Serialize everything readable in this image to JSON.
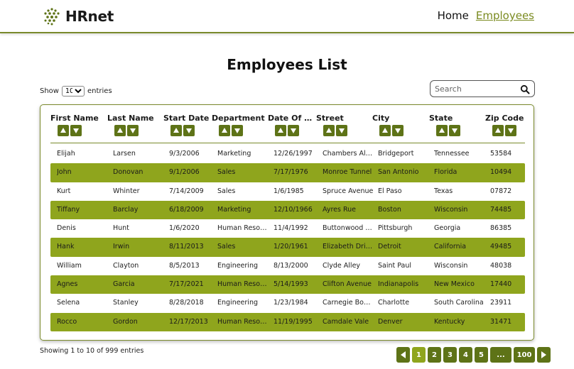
{
  "app": {
    "name": "HRnet"
  },
  "nav": {
    "home": "Home",
    "employees": "Employees"
  },
  "page": {
    "title": "Employees List"
  },
  "length": {
    "prefix": "Show",
    "value": "10",
    "suffix": "entries"
  },
  "search": {
    "placeholder": "Search"
  },
  "table": {
    "columns": [
      "First Name",
      "Last Name",
      "Start Date",
      "Department",
      "Date Of Birth",
      "Street",
      "City",
      "State",
      "Zip Code"
    ],
    "rows": [
      [
        "Elijah",
        "Larsen",
        "9/3/2006",
        "Marketing",
        "12/26/1997",
        "Chambers Alley",
        "Bridgeport",
        "Tennessee",
        "53584"
      ],
      [
        "John",
        "Donovan",
        "9/1/2006",
        "Sales",
        "7/17/1976",
        "Monroe Tunnel",
        "San Antonio",
        "Florida",
        "10494"
      ],
      [
        "Kurt",
        "Whinter",
        "7/14/2009",
        "Sales",
        "1/6/1985",
        "Spruce Avenue",
        "El Paso",
        "Texas",
        "07872"
      ],
      [
        "Tiffany",
        "Barclay",
        "6/18/2009",
        "Marketing",
        "12/10/1966",
        "Ayres Rue",
        "Boston",
        "Wisconsin",
        "74485"
      ],
      [
        "Denis",
        "Hunt",
        "1/6/2020",
        "Human Resources",
        "11/4/1992",
        "Buttonwood Drive",
        "Pittsburgh",
        "Georgia",
        "86385"
      ],
      [
        "Hank",
        "Irwin",
        "8/11/2013",
        "Sales",
        "1/20/1961",
        "Elizabeth Drive",
        "Detroit",
        "California",
        "49485"
      ],
      [
        "William",
        "Clayton",
        "8/5/2013",
        "Engineering",
        "8/13/2000",
        "Clyde Alley",
        "Saint Paul",
        "Wisconsin",
        "48038"
      ],
      [
        "Agnes",
        "Garcia",
        "7/17/2021",
        "Human Resources",
        "5/14/1993",
        "Clifton Avenue",
        "Indianapolis",
        "New Mexico",
        "17440"
      ],
      [
        "Selena",
        "Stanley",
        "8/28/2018",
        "Engineering",
        "1/23/1984",
        "Carnegie Boulevard",
        "Charlotte",
        "South Carolina",
        "23911"
      ],
      [
        "Rocco",
        "Gordon",
        "12/17/2013",
        "Human Resources",
        "11/19/1995",
        "Camdale Vale",
        "Denver",
        "Kentucky",
        "31471"
      ]
    ]
  },
  "info": "Showing 1 to 10 of 999 entries",
  "pagination": {
    "pages": [
      "1",
      "2",
      "3",
      "4",
      "5",
      "...",
      "100"
    ],
    "current": "1"
  },
  "colors": {
    "accent": "#5e7317",
    "row_highlight": "#8fa51d",
    "border": "#7a8a2c",
    "link_active": "#7a8a1f"
  }
}
